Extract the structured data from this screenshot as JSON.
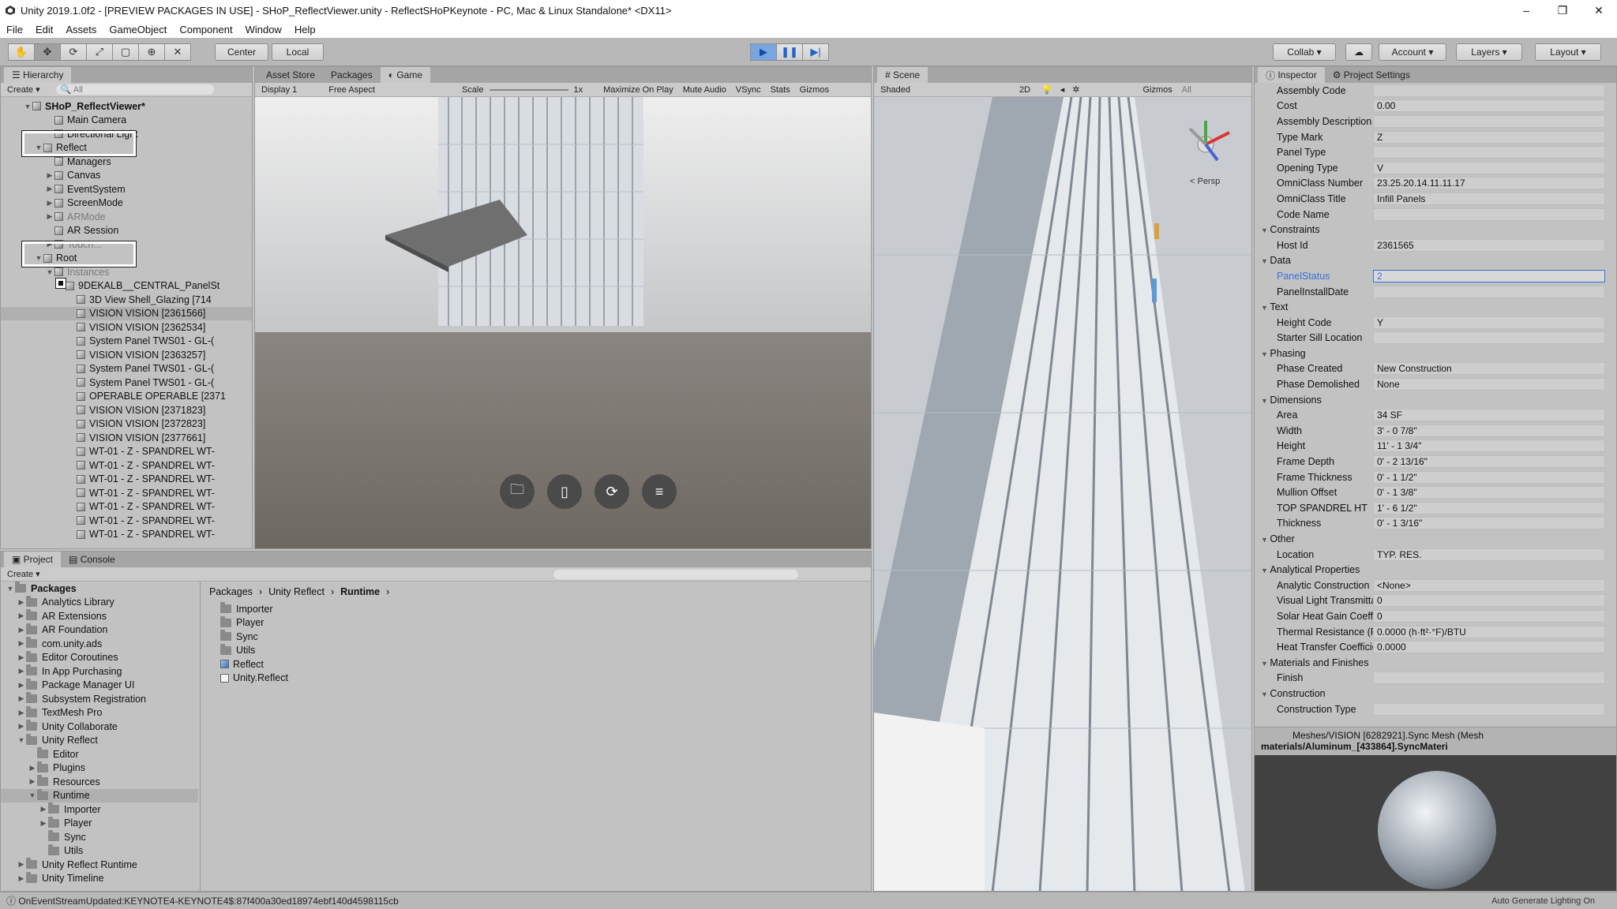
{
  "window": {
    "title": "Unity 2019.1.0f2 - [PREVIEW PACKAGES IN USE] - SHoP_ReflectViewer.unity - ReflectSHoPKeynote - PC, Mac & Linux Standalone* <DX11>",
    "controls": [
      "–",
      "❐",
      "✕"
    ]
  },
  "menu": [
    "File",
    "Edit",
    "Assets",
    "GameObject",
    "Component",
    "Window",
    "Help"
  ],
  "toolbar": {
    "center": "Center",
    "local": "Local",
    "collab": "Collab",
    "account": "Account",
    "layers": "Layers",
    "layout": "Layout"
  },
  "hierarchy": {
    "tab": "Hierarchy",
    "create": "Create",
    "search": "All",
    "items": [
      {
        "indent": 0,
        "label": "SHoP_ReflectViewer*",
        "arrow": "▼",
        "bold": true
      },
      {
        "indent": 2,
        "label": "Main Camera",
        "arrow": ""
      },
      {
        "indent": 2,
        "label": "Directional Light",
        "arrow": ""
      },
      {
        "indent": 1,
        "label": "Reflect",
        "arrow": "▼"
      },
      {
        "indent": 2,
        "label": "Managers",
        "arrow": ""
      },
      {
        "indent": 2,
        "label": "Canvas",
        "arrow": "▶"
      },
      {
        "indent": 2,
        "label": "EventSystem",
        "arrow": "▶"
      },
      {
        "indent": 2,
        "label": "ScreenMode",
        "arrow": "▶"
      },
      {
        "indent": 2,
        "label": "ARMode",
        "arrow": "▶",
        "dim": true
      },
      {
        "indent": 2,
        "label": "AR Session",
        "arrow": ""
      },
      {
        "indent": 2,
        "label": "Touch...",
        "arrow": "▶",
        "dim": true
      },
      {
        "indent": 1,
        "label": "Root",
        "arrow": "▼"
      },
      {
        "indent": 2,
        "label": "Instances",
        "arrow": "▼",
        "dim": true
      },
      {
        "indent": 3,
        "label": "9DEKALB__CENTRAL_PanelSt",
        "arrow": "▼"
      },
      {
        "indent": 4,
        "label": "3D View Shell_Glazing [714",
        "arrow": ""
      },
      {
        "indent": 4,
        "label": "VISION VISION [2361566]",
        "arrow": "",
        "selected": true
      },
      {
        "indent": 4,
        "label": "VISION VISION [2362534]",
        "arrow": ""
      },
      {
        "indent": 4,
        "label": "System Panel TWS01 - GL-(",
        "arrow": ""
      },
      {
        "indent": 4,
        "label": "VISION VISION [2363257]",
        "arrow": ""
      },
      {
        "indent": 4,
        "label": "System Panel TWS01 - GL-(",
        "arrow": ""
      },
      {
        "indent": 4,
        "label": "System Panel TWS01 - GL-(",
        "arrow": ""
      },
      {
        "indent": 4,
        "label": "OPERABLE OPERABLE [2371",
        "arrow": ""
      },
      {
        "indent": 4,
        "label": "VISION VISION [2371823]",
        "arrow": ""
      },
      {
        "indent": 4,
        "label": "VISION VISION [2372823]",
        "arrow": ""
      },
      {
        "indent": 4,
        "label": "VISION VISION [2377661]",
        "arrow": ""
      },
      {
        "indent": 4,
        "label": "WT-01 - Z - SPANDREL WT-",
        "arrow": ""
      },
      {
        "indent": 4,
        "label": "WT-01 - Z - SPANDREL WT-",
        "arrow": ""
      },
      {
        "indent": 4,
        "label": "WT-01 - Z - SPANDREL WT-",
        "arrow": ""
      },
      {
        "indent": 4,
        "label": "WT-01 - Z - SPANDREL WT-",
        "arrow": ""
      },
      {
        "indent": 4,
        "label": "WT-01 - Z - SPANDREL WT-",
        "arrow": ""
      },
      {
        "indent": 4,
        "label": "WT-01 - Z - SPANDREL WT-",
        "arrow": ""
      },
      {
        "indent": 4,
        "label": "WT-01 - Z - SPANDREL WT-",
        "arrow": ""
      }
    ]
  },
  "game": {
    "tabs": [
      "Asset Store",
      "Packages",
      "Game"
    ],
    "display": "Display 1",
    "aspect": "Free Aspect",
    "scale_label": "Scale",
    "scale_value": "1x",
    "options": [
      "Maximize On Play",
      "Mute Audio",
      "VSync",
      "Stats",
      "Gizmos"
    ],
    "buttons": [
      "folder-icon",
      "phone-icon",
      "sync-icon",
      "filter-icon"
    ]
  },
  "scene": {
    "tab": "Scene",
    "mode": "Shaded",
    "mode2d": "2D",
    "gizmos": "Gizmos",
    "search": "All",
    "persp": "< Persp"
  },
  "inspector": {
    "tabs": [
      "Inspector",
      "Project Settings"
    ],
    "rows": [
      {
        "label": "Assembly Code",
        "value": ""
      },
      {
        "label": "Cost",
        "value": "0.00"
      },
      {
        "label": "Assembly Description",
        "value": ""
      },
      {
        "label": "Type Mark",
        "value": "Z"
      },
      {
        "label": "Panel Type",
        "value": ""
      },
      {
        "label": "Opening Type",
        "value": "V"
      },
      {
        "label": "OmniClass Number",
        "value": "23.25.20.14.11.11.17"
      },
      {
        "label": "OmniClass Title",
        "value": "Infill Panels"
      },
      {
        "label": "Code Name",
        "value": ""
      },
      {
        "label": "Constraints",
        "section": true
      },
      {
        "label": "Host Id",
        "value": "2361565"
      },
      {
        "label": "Data",
        "section": true
      },
      {
        "label": "PanelStatus",
        "value": "2",
        "highlight": true
      },
      {
        "label": "PanelInstallDate",
        "value": ""
      },
      {
        "label": "Text",
        "section": true
      },
      {
        "label": "Height Code",
        "value": "Y"
      },
      {
        "label": "Starter Sill Location",
        "value": ""
      },
      {
        "label": "Phasing",
        "section": true
      },
      {
        "label": "Phase Created",
        "value": "New Construction"
      },
      {
        "label": "Phase Demolished",
        "value": "None"
      },
      {
        "label": "Dimensions",
        "section": true
      },
      {
        "label": "Area",
        "value": "34 SF"
      },
      {
        "label": "Width",
        "value": "3' - 0 7/8\""
      },
      {
        "label": "Height",
        "value": "11' - 1 3/4\""
      },
      {
        "label": "Frame Depth",
        "value": "0' - 2 13/16\""
      },
      {
        "label": "Frame Thickness",
        "value": "0' - 1 1/2\""
      },
      {
        "label": "Mullion Offset",
        "value": "0' - 1 3/8\""
      },
      {
        "label": "TOP SPANDREL HT",
        "value": "1' - 6 1/2\""
      },
      {
        "label": "Thickness",
        "value": "0' - 1 3/16\""
      },
      {
        "label": "Other",
        "section": true
      },
      {
        "label": "Location",
        "value": "TYP. RES."
      },
      {
        "label": "Analytical Properties",
        "section": true
      },
      {
        "label": "Analytic Construction",
        "value": "<None>"
      },
      {
        "label": "Visual Light Transmittan",
        "value": "0"
      },
      {
        "label": "Solar Heat Gain Coeffici",
        "value": "0"
      },
      {
        "label": "Thermal Resistance (R)",
        "value": "0.0000 (h·ft²·°F)/BTU"
      },
      {
        "label": "Heat Transfer Coefficien",
        "value": "0.0000"
      },
      {
        "label": "Materials and Finishes",
        "section": true
      },
      {
        "label": "Finish",
        "value": ""
      },
      {
        "label": "Construction",
        "section": true
      },
      {
        "label": "Construction Type",
        "value": ""
      }
    ],
    "footer1": "Meshes/VISION [6282921].Sync Mesh (Mesh",
    "footer2": "materials/Aluminum_[433864].SyncMateri"
  },
  "project": {
    "tabs": [
      "Project",
      "Console"
    ],
    "create": "Create",
    "breadcrumb": [
      "Packages",
      "Unity Reflect",
      "Runtime"
    ],
    "tree": [
      {
        "indent": 0,
        "label": "Packages",
        "arrow": "▼",
        "bold": true
      },
      {
        "indent": 1,
        "label": "Analytics Library",
        "arrow": "▶"
      },
      {
        "indent": 1,
        "label": "AR Extensions",
        "arrow": "▶"
      },
      {
        "indent": 1,
        "label": "AR Foundation",
        "arrow": "▶"
      },
      {
        "indent": 1,
        "label": "com.unity.ads",
        "arrow": "▶"
      },
      {
        "indent": 1,
        "label": "Editor Coroutines",
        "arrow": "▶"
      },
      {
        "indent": 1,
        "label": "In App Purchasing",
        "arrow": "▶"
      },
      {
        "indent": 1,
        "label": "Package Manager UI",
        "arrow": "▶"
      },
      {
        "indent": 1,
        "label": "Subsystem Registration",
        "arrow": "▶"
      },
      {
        "indent": 1,
        "label": "TextMesh Pro",
        "arrow": "▶"
      },
      {
        "indent": 1,
        "label": "Unity Collaborate",
        "arrow": "▶"
      },
      {
        "indent": 1,
        "label": "Unity Reflect",
        "arrow": "▼"
      },
      {
        "indent": 2,
        "label": "Editor",
        "arrow": ""
      },
      {
        "indent": 2,
        "label": "Plugins",
        "arrow": "▶"
      },
      {
        "indent": 2,
        "label": "Resources",
        "arrow": "▶"
      },
      {
        "indent": 2,
        "label": "Runtime",
        "arrow": "▼",
        "selected": true
      },
      {
        "indent": 3,
        "label": "Importer",
        "arrow": "▶"
      },
      {
        "indent": 3,
        "label": "Player",
        "arrow": "▶"
      },
      {
        "indent": 3,
        "label": "Sync",
        "arrow": ""
      },
      {
        "indent": 3,
        "label": "Utils",
        "arrow": ""
      },
      {
        "indent": 1,
        "label": "Unity Reflect Runtime",
        "arrow": "▶"
      },
      {
        "indent": 1,
        "label": "Unity Timeline",
        "arrow": "▶"
      }
    ],
    "files": [
      {
        "label": "Importer",
        "kind": "folder"
      },
      {
        "label": "Player",
        "kind": "folder"
      },
      {
        "label": "Sync",
        "kind": "folder"
      },
      {
        "label": "Utils",
        "kind": "folder"
      },
      {
        "label": "Reflect",
        "kind": "asset"
      },
      {
        "label": "Unity.Reflect",
        "kind": "file"
      }
    ]
  },
  "status": {
    "message": "OnEventStreamUpdated:KEYNOTE4-KEYNOTE4$:87f400a30ed18974ebf140d4598115cb",
    "right": "Auto Generate Lighting On"
  }
}
